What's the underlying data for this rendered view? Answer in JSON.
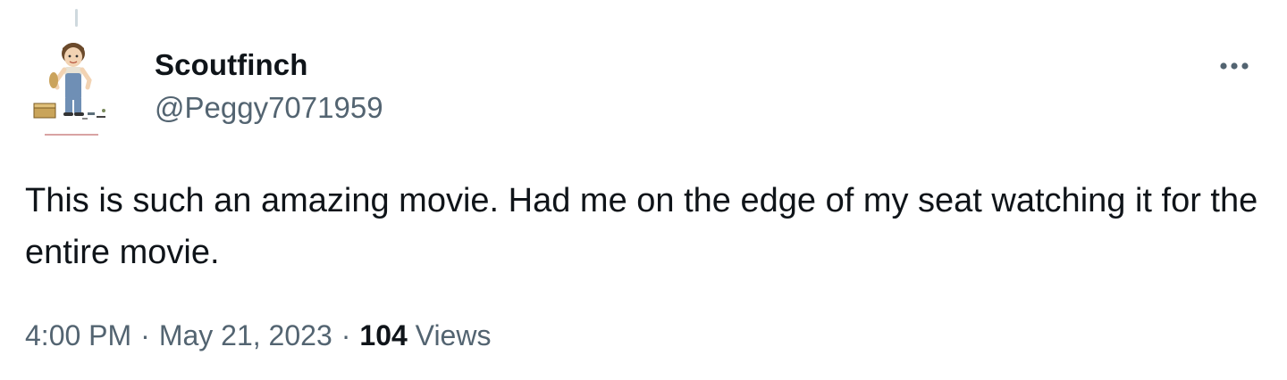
{
  "author": {
    "display_name": "Scoutfinch",
    "handle": "@Peggy7071959",
    "avatar_caption": "\"Jean Louise \"Scout\" Finch\""
  },
  "icons": {
    "more": "more-horizontal-icon",
    "avatar": "avatar-illustration"
  },
  "tweet": {
    "text": "This is such an amazing movie. Had me on the edge of my seat watching it for the entire movie.",
    "time": "4:00 PM",
    "separator_1": "·",
    "date": "May 21, 2023",
    "separator_2": "·",
    "views_count": "104",
    "views_label": "Views"
  },
  "colors": {
    "text_primary": "#0f1419",
    "text_secondary": "#536471",
    "thread_line": "#cfd9de"
  }
}
